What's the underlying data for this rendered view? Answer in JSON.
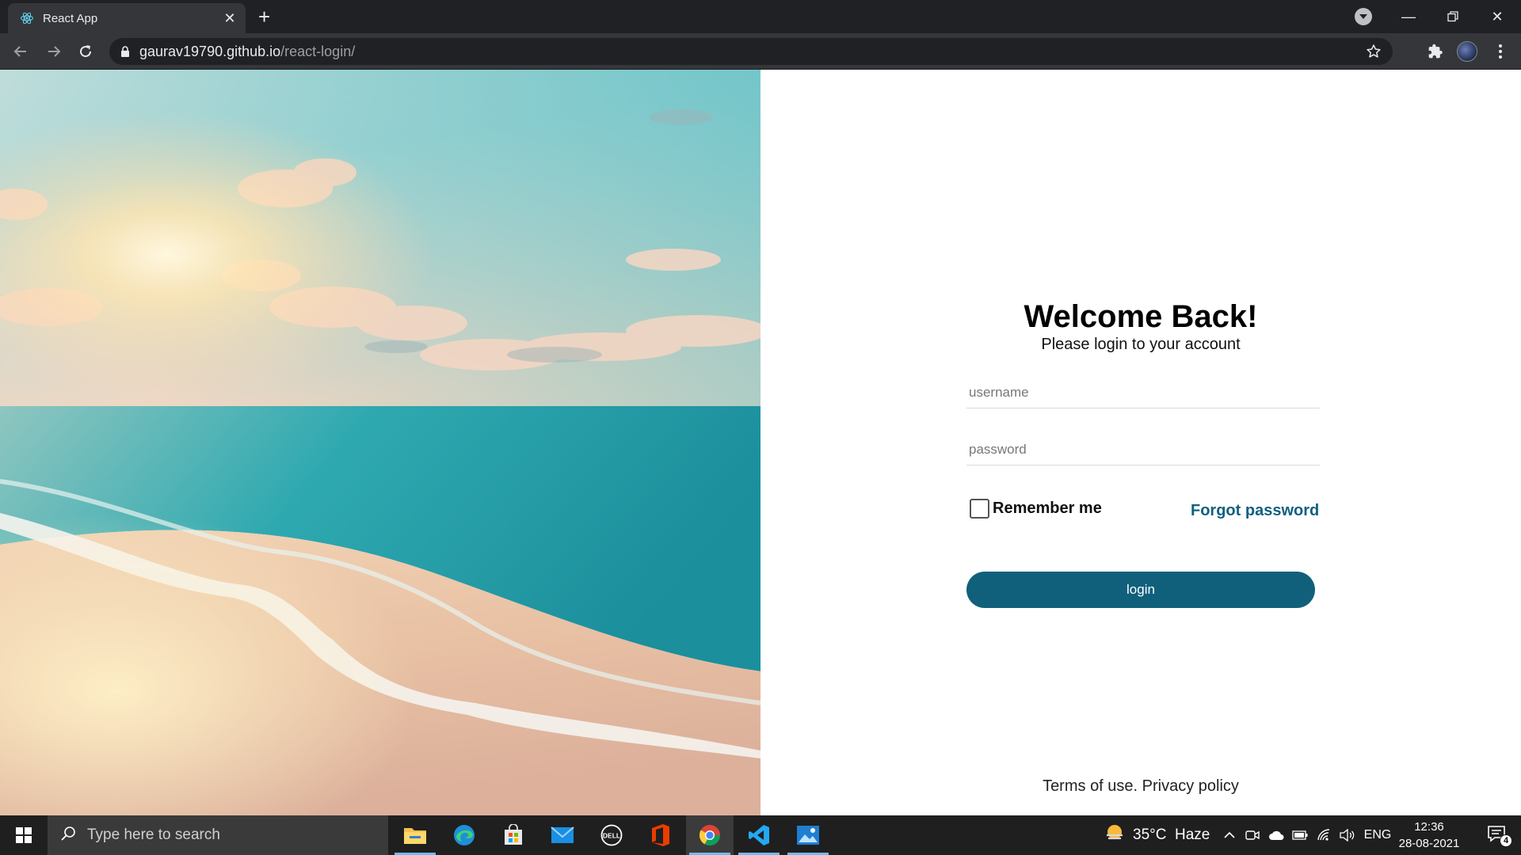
{
  "browser": {
    "tab_title": "React App",
    "url_host": "gaurav19790.github.io",
    "url_path": "/react-login/"
  },
  "login": {
    "title": "Welcome Back!",
    "subtitle": "Please login to your account",
    "username_placeholder": "username",
    "password_placeholder": "password",
    "remember_label": "Remember me",
    "forgot_label": "Forgot password",
    "login_label": "login",
    "terms_label": "Terms of use.",
    "privacy_label": "Privacy policy"
  },
  "taskbar": {
    "search_placeholder": "Type here to search",
    "weather": "35°C  Haze",
    "language": "ENG",
    "time": "12:36",
    "date": "28-08-2021",
    "notification_count": "4"
  },
  "colors": {
    "accent": "#10607c",
    "link": "#10607f"
  }
}
